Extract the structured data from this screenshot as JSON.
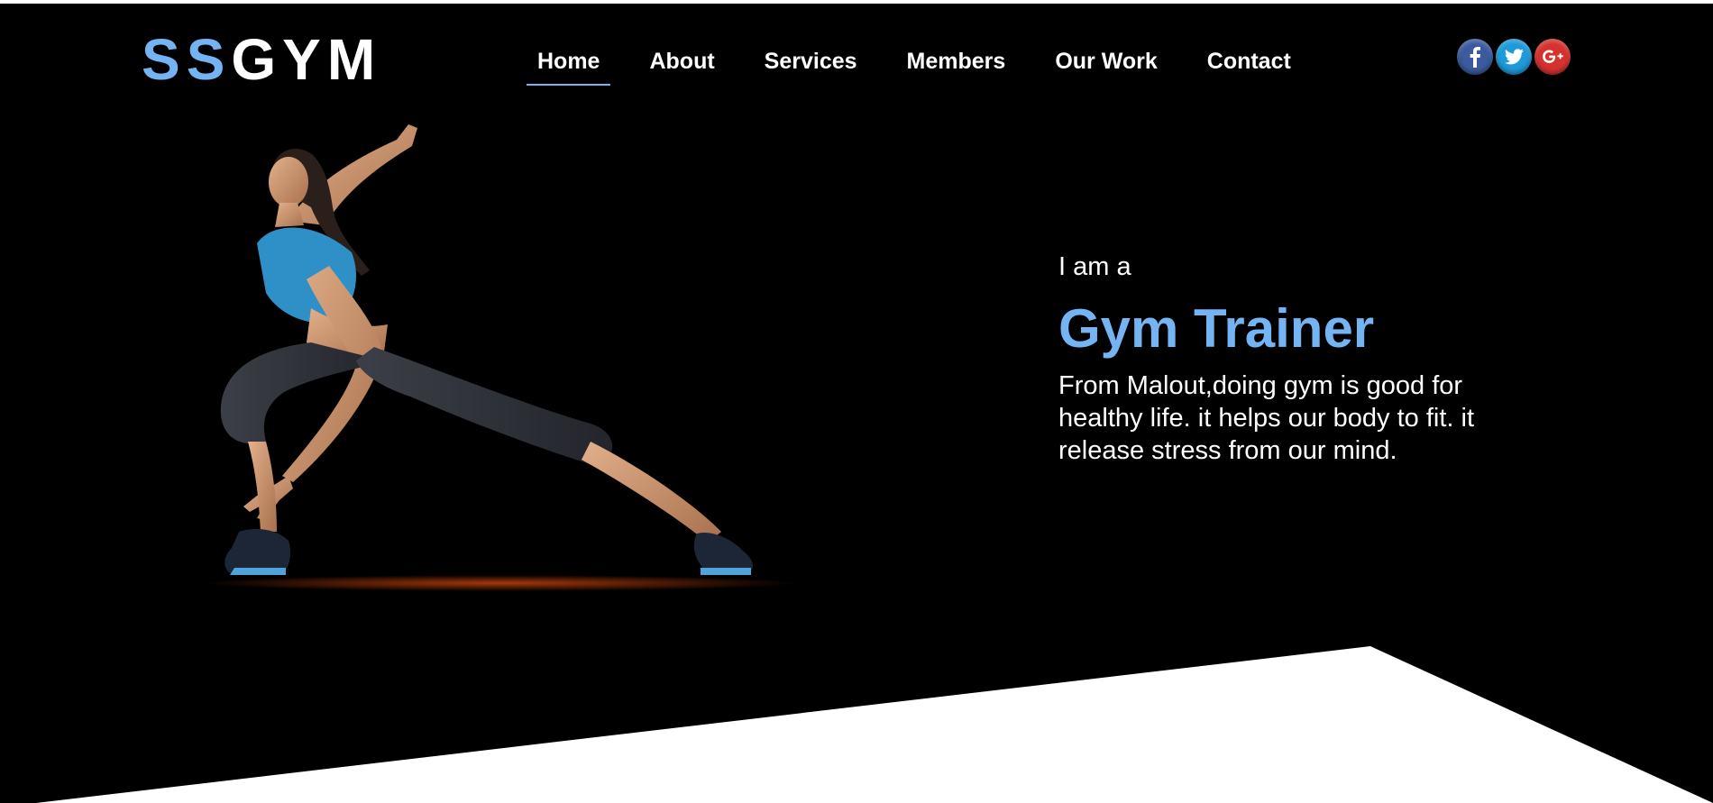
{
  "brand": {
    "logo_part1": "SS",
    "logo_part2": "GYM",
    "accent_color": "#74b4f2",
    "background_color": "#000000"
  },
  "nav": {
    "items": [
      {
        "label": "Home",
        "active": true
      },
      {
        "label": "About",
        "active": false
      },
      {
        "label": "Services",
        "active": false
      },
      {
        "label": "Members",
        "active": false
      },
      {
        "label": "Our Work",
        "active": false
      },
      {
        "label": "Contact",
        "active": false
      }
    ]
  },
  "social": [
    {
      "icon": "facebook-icon",
      "glyph": "f",
      "color": "#3b5b9e"
    },
    {
      "icon": "twitter-icon",
      "glyph": "bird",
      "color": "#1e9ad8"
    },
    {
      "icon": "google-plus-icon",
      "glyph": "g+",
      "color": "#d5322f"
    }
  ],
  "hero": {
    "intro": "I am a",
    "headline": "Gym Trainer",
    "description": "From Malout,doing gym is good for healthy life. it helps our body to fit. it release stress from our mind.",
    "image": "athlete-lunge-photo"
  }
}
